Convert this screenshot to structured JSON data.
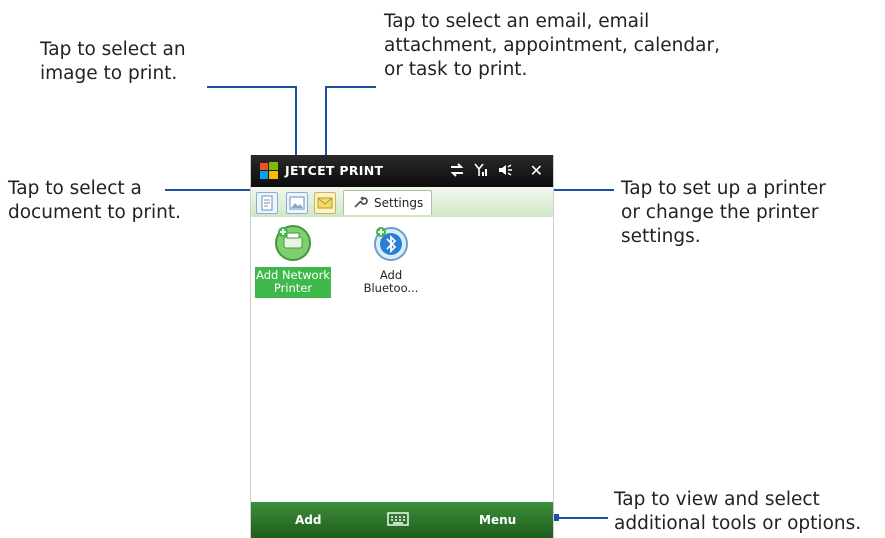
{
  "callouts": {
    "image": [
      "Tap to select an",
      "image to print."
    ],
    "email": [
      "Tap to select an email, email",
      "attachment, appointment, calendar,",
      "or task to print."
    ],
    "document": [
      "Tap to select a",
      "document to print."
    ],
    "settings": [
      "Tap to set up a printer",
      "or change the printer",
      "settings."
    ],
    "menu": [
      "Tap to view and select",
      "additional tools or options."
    ]
  },
  "phone": {
    "title": "JETCET PRINT",
    "tabs": {
      "settings_label": "Settings"
    },
    "items": [
      {
        "label_line1": "Add Network",
        "label_line2": "Printer"
      },
      {
        "label_line1": "Add",
        "label_line2": "Bluetoo..."
      }
    ],
    "softkeys": {
      "left": "Add",
      "right": "Menu"
    },
    "icons": [
      "windows-start-icon",
      "sync-icon",
      "signal-icon",
      "volume-icon",
      "close-icon",
      "document-tab-icon",
      "image-tab-icon",
      "email-tab-icon",
      "wrench-icon",
      "network-printer-icon",
      "bluetooth-printer-icon",
      "keyboard-icon"
    ],
    "colors": {
      "title_bg": "#111111",
      "tab_bg": "#d8ecd2",
      "selected_item": "#3fb84a",
      "softkey_bg": "#2e7a2b",
      "callout_line": "#1f4fa0"
    }
  }
}
